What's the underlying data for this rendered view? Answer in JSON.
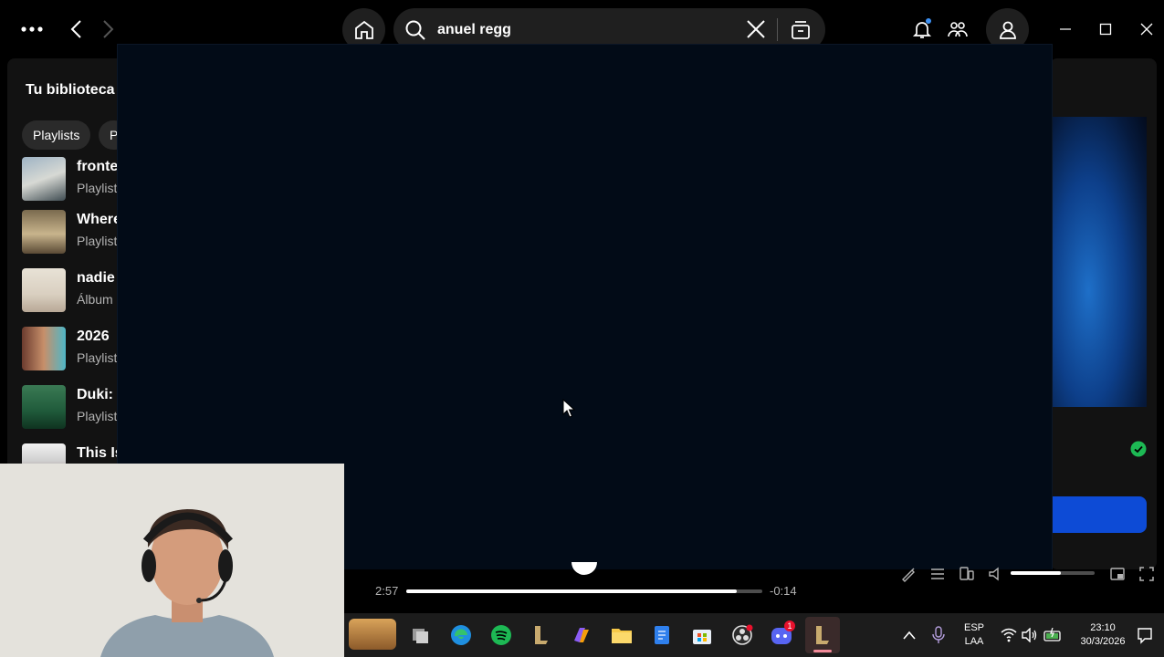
{
  "search": {
    "query": "anuel regg"
  },
  "library": {
    "title": "Tu biblioteca",
    "chips": [
      "Playlists",
      "P"
    ],
    "items": [
      {
        "name": "fronte",
        "sub": "Playlist"
      },
      {
        "name": "Where",
        "sub": "Playlist"
      },
      {
        "name": "nadie",
        "sub": "Álbum"
      },
      {
        "name": "2026",
        "sub": "Playlist"
      },
      {
        "name": "Duki: T",
        "sub": "Playlist"
      },
      {
        "name": "This Is",
        "sub": ""
      }
    ]
  },
  "player": {
    "elapsed": "2:57",
    "remaining": "-0:14",
    "progress_fraction": 0.927,
    "volume_fraction": 0.6
  },
  "taskbar": {
    "lang_top": "ESP",
    "lang_bottom": "LAA",
    "time": "23:10",
    "date": "30/3/2026",
    "discord_badge": "1"
  },
  "colors": {
    "spotify_green": "#1db954",
    "accent_blue": "#0d4bd6",
    "overlay": "#020b17"
  }
}
